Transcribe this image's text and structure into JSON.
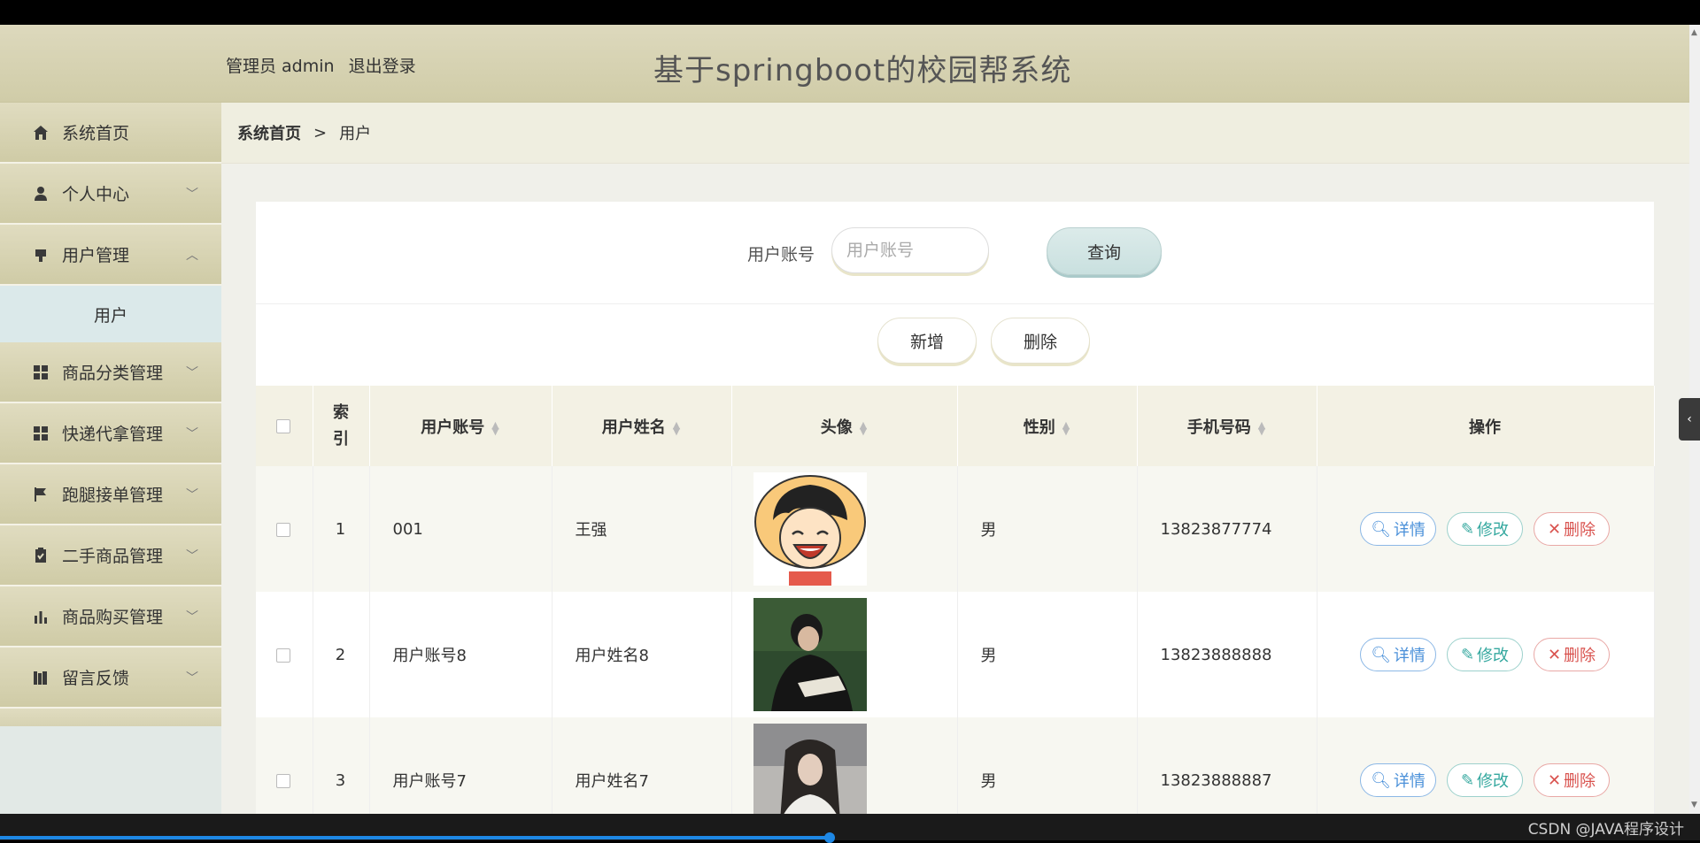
{
  "header": {
    "user_role": "管理员 admin",
    "logout": "退出登录",
    "title": "基于springboot的校园帮系统"
  },
  "sidebar": {
    "items": [
      {
        "label": "系统首页",
        "icon": "home-icon"
      },
      {
        "label": "个人中心",
        "icon": "person-icon"
      },
      {
        "label": "用户管理",
        "icon": "user-management-icon"
      },
      {
        "label": "商品分类管理",
        "icon": "grid-icon"
      },
      {
        "label": "快递代拿管理",
        "icon": "grid-icon"
      },
      {
        "label": "跑腿接单管理",
        "icon": "flag-icon"
      },
      {
        "label": "二手商品管理",
        "icon": "clipboard-icon"
      },
      {
        "label": "商品购买管理",
        "icon": "bar-chart-icon"
      },
      {
        "label": "留言反馈",
        "icon": "books-icon"
      }
    ],
    "sub_item": "用户"
  },
  "breadcrumb": {
    "home": "系统首页",
    "separator": ">",
    "current": "用户"
  },
  "search": {
    "label": "用户账号",
    "placeholder": "用户账号",
    "button": "查询"
  },
  "actions": {
    "add": "新增",
    "delete": "删除"
  },
  "table": {
    "headers": {
      "index": "索引",
      "account": "用户账号",
      "name": "用户姓名",
      "avatar": "头像",
      "gender": "性别",
      "phone": "手机号码",
      "ops": "操作"
    },
    "rows": [
      {
        "index": "1",
        "account": "001",
        "name": "王强",
        "gender": "男",
        "phone": "13823877774",
        "avatar": "cartoon-avatar"
      },
      {
        "index": "2",
        "account": "用户账号8",
        "name": "用户姓名8",
        "gender": "男",
        "phone": "13823888888",
        "avatar": "photo-reading-avatar"
      },
      {
        "index": "3",
        "account": "用户账号7",
        "name": "用户姓名7",
        "gender": "男",
        "phone": "13823888887",
        "avatar": "photo-girl-avatar"
      }
    ],
    "op_labels": {
      "detail": "详情",
      "edit": "修改",
      "delete": "删除"
    }
  },
  "watermark": "CSDN @JAVA程序设计",
  "colors": {
    "header_bg": "#d6d2b2",
    "detail": "#4a90d9",
    "edit": "#35a89f",
    "delete": "#d9534f"
  }
}
